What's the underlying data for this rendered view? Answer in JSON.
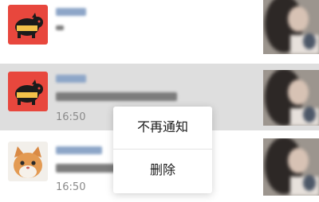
{
  "feed": {
    "items": [
      {
        "time": ""
      },
      {
        "time": "16:50"
      },
      {
        "time": "16:50"
      }
    ]
  },
  "context_menu": {
    "items": [
      {
        "label": "不再通知"
      },
      {
        "label": "删除"
      }
    ]
  },
  "colors": {
    "avatar_red": "#e8473d",
    "highlight_row": "#dedede",
    "blurred_name": "#8da6c8"
  }
}
